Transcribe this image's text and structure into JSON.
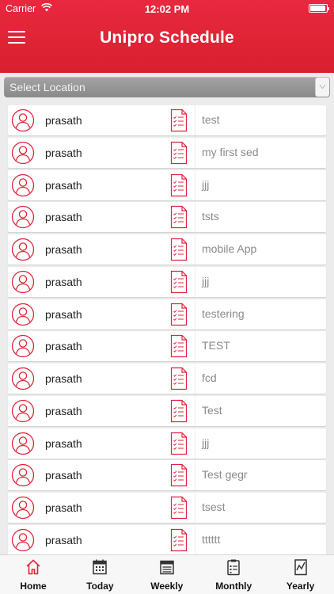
{
  "status_bar": {
    "carrier": "Carrier",
    "time": "12:02 PM",
    "battery_level": 0.95
  },
  "header": {
    "title": "Unipro Schedule"
  },
  "location": {
    "placeholder": "Select Location"
  },
  "rows": [
    {
      "name": "prasath",
      "topic": "test"
    },
    {
      "name": "prasath",
      "topic": "my first sed"
    },
    {
      "name": "prasath",
      "topic": "jjj"
    },
    {
      "name": "prasath",
      "topic": "tsts"
    },
    {
      "name": "prasath",
      "topic": "mobile App"
    },
    {
      "name": "prasath",
      "topic": "jjj"
    },
    {
      "name": "prasath",
      "topic": "testering"
    },
    {
      "name": "prasath",
      "topic": "TEST"
    },
    {
      "name": "prasath",
      "topic": "fcd"
    },
    {
      "name": "prasath",
      "topic": "Test"
    },
    {
      "name": "prasath",
      "topic": "jjj"
    },
    {
      "name": "prasath",
      "topic": "Test gegr"
    },
    {
      "name": "prasath",
      "topic": "tsest"
    },
    {
      "name": "prasath",
      "topic": "tttttt"
    }
  ],
  "tabs": [
    {
      "label": "Home",
      "icon": "home-icon",
      "active": true
    },
    {
      "label": "Today",
      "icon": "today-calendar-icon",
      "active": false
    },
    {
      "label": "Weekly",
      "icon": "weekly-calendar-icon",
      "active": false
    },
    {
      "label": "Monthly",
      "icon": "monthly-clipboard-icon",
      "active": false
    },
    {
      "label": "Yearly",
      "icon": "yearly-chart-icon",
      "active": false
    }
  ],
  "colors": {
    "brand": "#e0243a",
    "accent": "#e0243a",
    "tab_icon": "#333333"
  }
}
